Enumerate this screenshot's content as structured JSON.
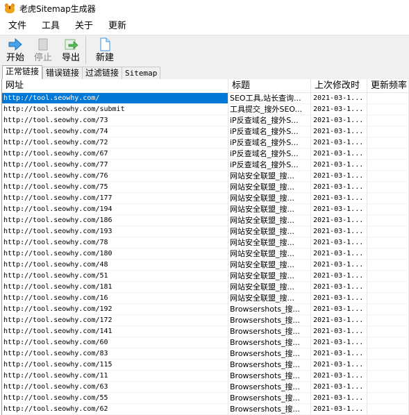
{
  "window": {
    "title": "老虎Sitemap生成器"
  },
  "menu": [
    "文件",
    "工具",
    "关于",
    "更新"
  ],
  "toolbar": {
    "start_label": "开始",
    "stop_label": "停止",
    "export_label": "导出",
    "new_label": "新建"
  },
  "tabs": [
    "正常链接",
    "错误链接",
    "过滤链接",
    "Sitemap"
  ],
  "table": {
    "headers": [
      "网址",
      "标题",
      "上次修改时",
      "更新频率"
    ],
    "rows": [
      {
        "url": "http://tool.seowhy.com/",
        "title": "SEO工具,站长查询...",
        "date": "2021-03-1..."
      },
      {
        "url": "http://tool.seowhy.com/submit",
        "title": "工具提交_搜外SEO...",
        "date": "2021-03-1..."
      },
      {
        "url": "http://tool.seowhy.com/73",
        "title": "iP反查域名_搜外S...",
        "date": "2021-03-1..."
      },
      {
        "url": "http://tool.seowhy.com/74",
        "title": "iP反查域名_搜外S...",
        "date": "2021-03-1..."
      },
      {
        "url": "http://tool.seowhy.com/72",
        "title": "iP反查域名_搜外S...",
        "date": "2021-03-1..."
      },
      {
        "url": "http://tool.seowhy.com/67",
        "title": "iP反查域名_搜外S...",
        "date": "2021-03-1..."
      },
      {
        "url": "http://tool.seowhy.com/77",
        "title": "iP反查域名_搜外S...",
        "date": "2021-03-1..."
      },
      {
        "url": "http://tool.seowhy.com/76",
        "title": "网站安全联盟_搜...",
        "date": "2021-03-1..."
      },
      {
        "url": "http://tool.seowhy.com/75",
        "title": "网站安全联盟_搜...",
        "date": "2021-03-1..."
      },
      {
        "url": "http://tool.seowhy.com/177",
        "title": "网站安全联盟_搜...",
        "date": "2021-03-1..."
      },
      {
        "url": "http://tool.seowhy.com/194",
        "title": "网站安全联盟_搜...",
        "date": "2021-03-1..."
      },
      {
        "url": "http://tool.seowhy.com/186",
        "title": "网站安全联盟_搜...",
        "date": "2021-03-1..."
      },
      {
        "url": "http://tool.seowhy.com/193",
        "title": "网站安全联盟_搜...",
        "date": "2021-03-1..."
      },
      {
        "url": "http://tool.seowhy.com/78",
        "title": "网站安全联盟_搜...",
        "date": "2021-03-1..."
      },
      {
        "url": "http://tool.seowhy.com/180",
        "title": "网站安全联盟_搜...",
        "date": "2021-03-1..."
      },
      {
        "url": "http://tool.seowhy.com/48",
        "title": "网站安全联盟_搜...",
        "date": "2021-03-1..."
      },
      {
        "url": "http://tool.seowhy.com/51",
        "title": "网站安全联盟_搜...",
        "date": "2021-03-1..."
      },
      {
        "url": "http://tool.seowhy.com/181",
        "title": "网站安全联盟_搜...",
        "date": "2021-03-1..."
      },
      {
        "url": "http://tool.seowhy.com/16",
        "title": "网站安全联盟_搜...",
        "date": "2021-03-1..."
      },
      {
        "url": "http://tool.seowhy.com/192",
        "title": "Browsershots_搜...",
        "date": "2021-03-1..."
      },
      {
        "url": "http://tool.seowhy.com/172",
        "title": "Browsershots_搜...",
        "date": "2021-03-1..."
      },
      {
        "url": "http://tool.seowhy.com/141",
        "title": "Browsershots_搜...",
        "date": "2021-03-1..."
      },
      {
        "url": "http://tool.seowhy.com/60",
        "title": "Browsershots_搜...",
        "date": "2021-03-1..."
      },
      {
        "url": "http://tool.seowhy.com/83",
        "title": "Browsershots_搜...",
        "date": "2021-03-1..."
      },
      {
        "url": "http://tool.seowhy.com/115",
        "title": "Browsershots_搜...",
        "date": "2021-03-1..."
      },
      {
        "url": "http://tool.seowhy.com/11",
        "title": "Browsershots_搜...",
        "date": "2021-03-1..."
      },
      {
        "url": "http://tool.seowhy.com/63",
        "title": "Browsershots_搜...",
        "date": "2021-03-1..."
      },
      {
        "url": "http://tool.seowhy.com/55",
        "title": "Browsershots_搜...",
        "date": "2021-03-1..."
      },
      {
        "url": "http://tool.seowhy.com/62",
        "title": "Browsershots_搜...",
        "date": "2021-03-1..."
      }
    ]
  },
  "colors": {
    "selection": "#0078d7",
    "toolbar_bg": "#f0f0f0"
  },
  "icons": [
    "tiger-app-icon",
    "start-arrow-icon",
    "stop-icon",
    "export-icon",
    "new-document-icon"
  ]
}
